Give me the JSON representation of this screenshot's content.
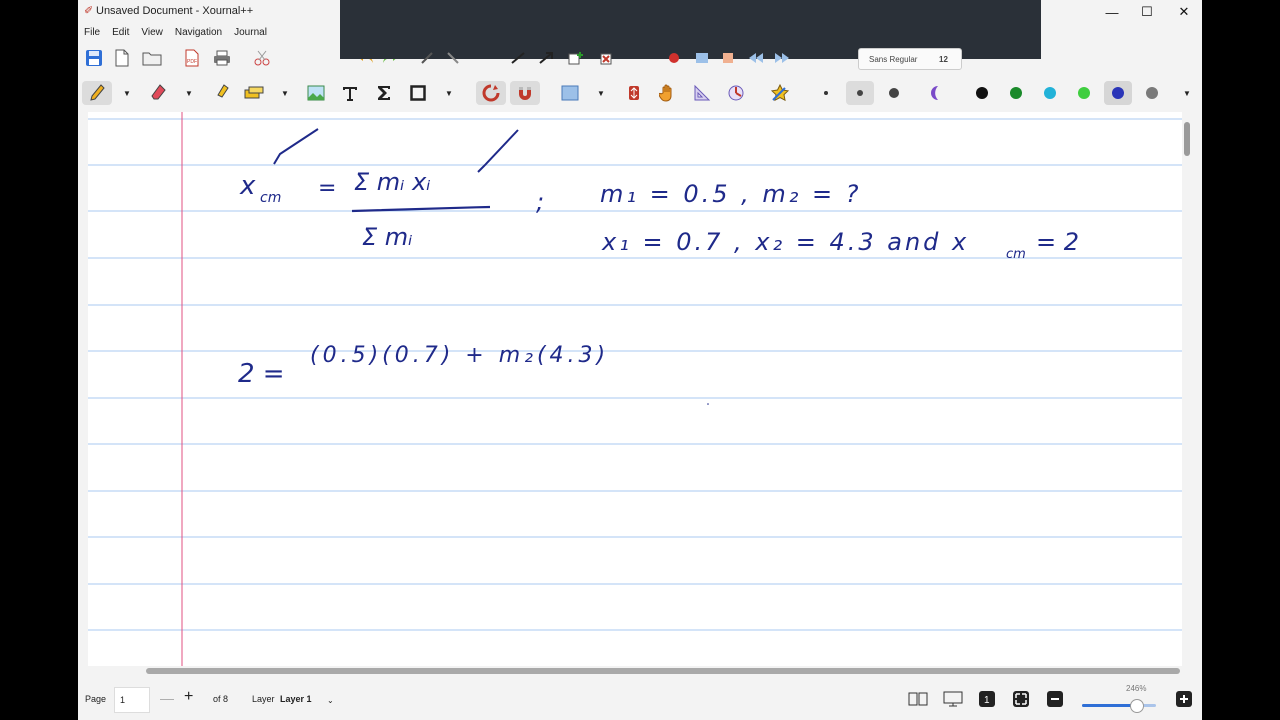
{
  "window": {
    "title": "Unsaved Document - Xournal++",
    "controls": {
      "minimize": "—",
      "maximize": "☐",
      "close": "✕"
    }
  },
  "menu": [
    "File",
    "Edit",
    "View",
    "Navigation",
    "Journal"
  ],
  "toolbar": {
    "font_name": "Sans Regular",
    "font_size": "12",
    "colors": [
      "#111111",
      "#1a8a2a",
      "#22b2d8",
      "#3fce3f",
      "#2a35b8",
      "#7a7a7a"
    ],
    "selected_color": "#2a35b8",
    "icons": [
      "save-icon",
      "new-icon",
      "open-icon",
      "pdf-icon",
      "print-icon",
      "cut-icon",
      "copy-icon",
      "paste-icon",
      "undo-icon",
      "redo-icon",
      "pen-icon",
      "eraser-icon",
      "highlighter-icon",
      "text-icon",
      "image-icon",
      "tex-icon",
      "shape-icon",
      "rotation-snap-icon",
      "grid-snap-icon",
      "select-rect-icon",
      "vertical-space-icon",
      "hand-icon",
      "setsquare-icon",
      "compass-icon",
      "default-tool-icon",
      "fill-icon"
    ]
  },
  "document": {
    "handwriting": {
      "eq_lhs": "x",
      "eq_lhs_sub": "cm",
      "equals": "=",
      "numerator": "Σ mᵢ xᵢ",
      "denominator": "Σ mᵢ",
      "separator": ";",
      "given_line1": "m₁ = 0.5 , m₂ = ?",
      "given_line2": "x₁ = 0.7 , x₂ = 4.3   and   x",
      "given_line2_sub": "cm",
      "given_line2_end": "= 2",
      "step_lhs": "2 =",
      "step_numerator": "(0.5)(0.7) + m₂(4.3)"
    }
  },
  "status": {
    "page_label": "Page",
    "page_value": "1",
    "page_total": "of 8",
    "layer_label": "Layer",
    "layer_value": "Layer 1",
    "zoom": "246%",
    "zoom_fraction": 0.73
  }
}
